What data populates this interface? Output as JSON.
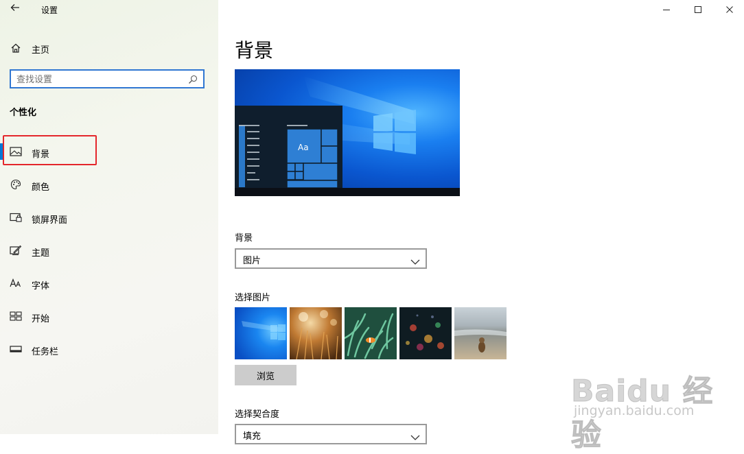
{
  "window": {
    "title": "设置",
    "controls": {
      "minimize": "minimize-icon",
      "maximize": "maximize-icon",
      "close": "close-icon"
    }
  },
  "sidebar": {
    "home_label": "主页",
    "search_placeholder": "查找设置",
    "section_heading": "个性化",
    "items": [
      {
        "label": "背景",
        "icon": "picture-icon",
        "active": true
      },
      {
        "label": "颜色",
        "icon": "palette-icon",
        "active": false
      },
      {
        "label": "锁屏界面",
        "icon": "lock-screen-icon",
        "active": false
      },
      {
        "label": "主题",
        "icon": "theme-brush-icon",
        "active": false
      },
      {
        "label": "字体",
        "icon": "font-icon",
        "active": false
      },
      {
        "label": "开始",
        "icon": "start-grid-icon",
        "active": false
      },
      {
        "label": "任务栏",
        "icon": "taskbar-icon",
        "active": false
      }
    ]
  },
  "main": {
    "title": "背景",
    "preview": {
      "tile_text": "Aa"
    },
    "background_label": "背景",
    "background_value": "图片",
    "choose_picture_label": "选择图片",
    "thumbnails": [
      "windows-blue",
      "autumn-grass",
      "anemone-clownfish",
      "rain-bokeh",
      "beach-figure"
    ],
    "browse_label": "浏览",
    "fit_label": "选择契合度",
    "fit_value": "填充"
  },
  "watermark": {
    "line1": "Baidu 经验",
    "line2": "jingyan.baidu.com"
  },
  "colors": {
    "accent": "#0078d7",
    "annotation": "#e4262b",
    "search_border": "#2f76d2"
  }
}
